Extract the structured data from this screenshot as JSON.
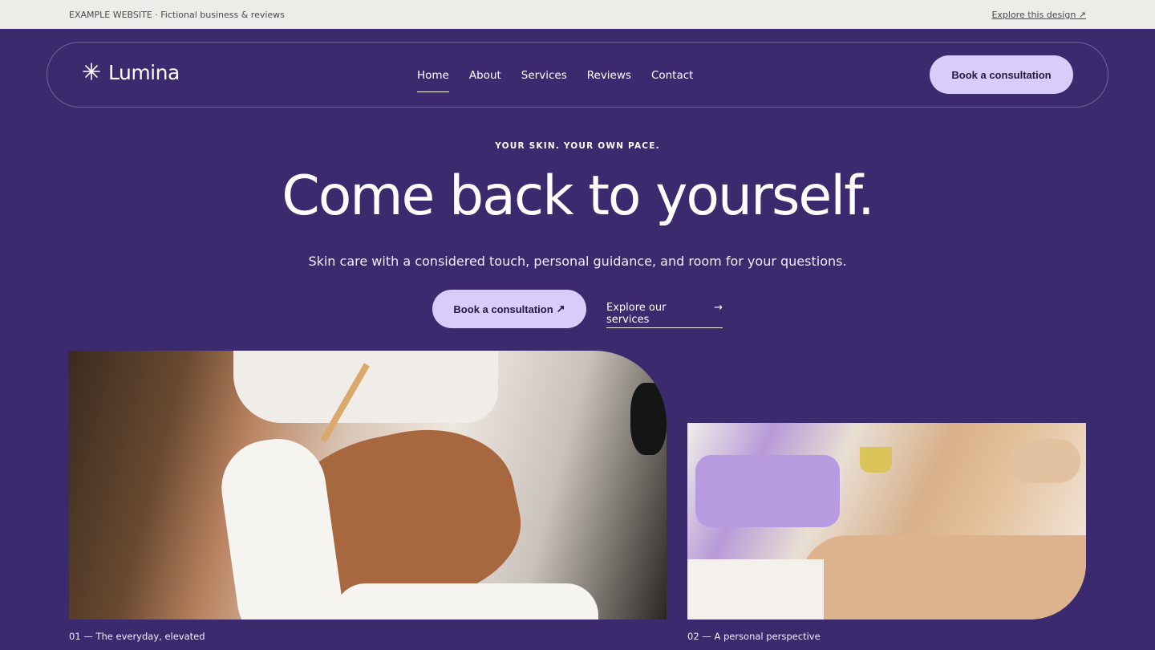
{
  "topbar": {
    "notice": "EXAMPLE WEBSITE · Fictional business & reviews",
    "link": "Explore this design ↗"
  },
  "brand": {
    "name": "Lumina",
    "icon": "sparkle-icon"
  },
  "nav": {
    "items": [
      {
        "label": "Home",
        "active": true
      },
      {
        "label": "About"
      },
      {
        "label": "Services"
      },
      {
        "label": "Reviews"
      },
      {
        "label": "Contact"
      }
    ],
    "cta": "Book a consultation"
  },
  "hero": {
    "eyebrow": "YOUR SKIN. YOUR OWN PACE.",
    "headline": "Come back to yourself.",
    "subhead": "Skin care with a considered touch, personal guidance, and room for your questions.",
    "primary_cta": "Book a consultation",
    "primary_cta_icon": "↗",
    "secondary_cta": "Explore our services",
    "secondary_cta_icon": "→"
  },
  "gallery": [
    {
      "caption": "01 — The everyday, elevated"
    },
    {
      "caption": "02 — A personal perspective"
    }
  ],
  "colors": {
    "background": "#3b2a6e",
    "accent": "#d8ccfb",
    "topbar": "#ecede8"
  }
}
